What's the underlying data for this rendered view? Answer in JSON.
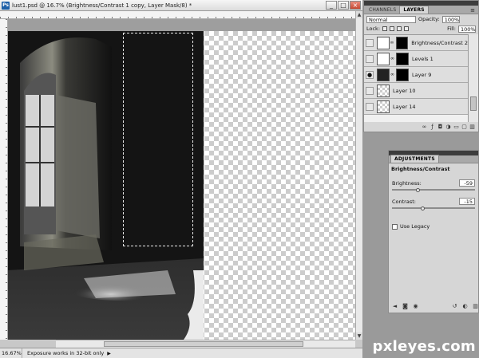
{
  "document": {
    "title": "lust1.psd @ 16.7% (Brightness/Contrast 1 copy, Layer Mask/8) *",
    "ps_logo": "Ps",
    "zoom": "16.67%",
    "status": "Exposure works in 32-bit only"
  },
  "window_controls": {
    "minimize": "_",
    "maximize": "□",
    "close": "×"
  },
  "layers_panel": {
    "tabs": [
      {
        "label": "CHANNELS"
      },
      {
        "label": "LAYERS"
      }
    ],
    "menu_icon": "≡",
    "blend_mode": "Normal",
    "opacity_label": "Opacity:",
    "opacity_value": "100%",
    "lock_label": "Lock:",
    "fill_label": "Fill:",
    "fill_value": "100%",
    "layers": [
      {
        "name": "Brightness/Contrast 2",
        "visible": false,
        "thumb": "adjustment"
      },
      {
        "name": "Levels 1",
        "visible": false,
        "thumb": "adjustment"
      },
      {
        "name": "Layer 9",
        "visible": true,
        "thumb": "image"
      },
      {
        "name": "Layer 10",
        "visible": false,
        "thumb": "image"
      },
      {
        "name": "Layer 14",
        "visible": false,
        "thumb": "transparent"
      }
    ],
    "footer_icons": [
      "link-icon",
      "fx-icon",
      "mask-icon",
      "adjustment-icon",
      "folder-icon",
      "new-layer-icon",
      "trash-icon"
    ]
  },
  "adjustments_panel": {
    "tab": "ADJUSTMENTS",
    "title": "Brightness/Contrast",
    "brightness_label": "Brightness:",
    "brightness_value": "-59",
    "contrast_label": "Contrast:",
    "contrast_value": "-15",
    "legacy_label": "Use Legacy"
  },
  "watermark": "pxleyes.com",
  "colors": {
    "panel_bg": "#d6d6d6",
    "canvas_bg": "#9e9e9e",
    "photo_dark": "#1a1a1a"
  }
}
